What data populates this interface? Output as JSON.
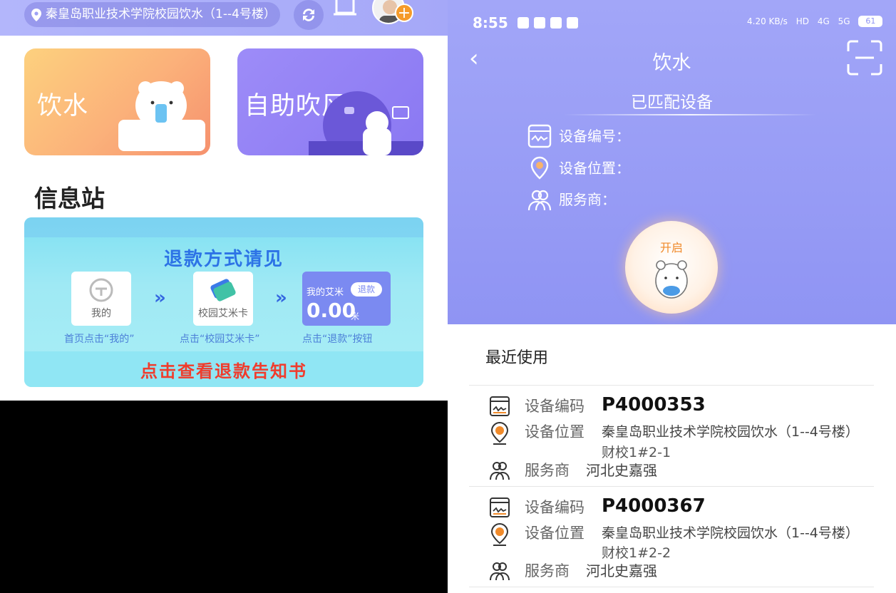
{
  "left": {
    "location": "秦皇岛职业技术学院校园饮水（1--4号楼）",
    "cards": {
      "water_label": "饮水",
      "dryer_label": "自助吹风"
    },
    "info_title": "信息站",
    "banner": {
      "title": "退款方式请见",
      "step1_box": "我的",
      "step2_box": "校园艾米卡",
      "step3_label": "我的艾米",
      "step3_tag": "退款",
      "step3_amount": "0.00",
      "step3_unit": "米",
      "step1_caption": "首页点击“我的”",
      "step2_caption": "点击“校园艾米卡”",
      "step3_caption": "点击“退款”按钮",
      "cta": "点击查看退款告知书"
    }
  },
  "right": {
    "status": {
      "time": "8:55",
      "speed": "4.20 KB/s",
      "net1": "HD",
      "net2": "4G",
      "net3": "5G",
      "battery": "61"
    },
    "title": "饮水",
    "matched": "已匹配设备",
    "device": {
      "code_label": "设备编号：",
      "location_label": "设备位置：",
      "vendor_label": "服务商："
    },
    "open_label": "开启",
    "recent_title": "最近使用",
    "recent": [
      {
        "code_key": "设备编码",
        "code": "P4000353",
        "loc_key": "设备位置",
        "loc": "秦皇岛职业技术学院校园饮水（1--4号楼）",
        "loc_sub": "财校1#2-1",
        "vendor_key": "服务商",
        "vendor": "河北史嘉强"
      },
      {
        "code_key": "设备编码",
        "code": "P4000367",
        "loc_key": "设备位置",
        "loc": "秦皇岛职业技术学院校园饮水（1--4号楼）",
        "loc_sub": "财校1#2-2",
        "vendor_key": "服务商",
        "vendor": "河北史嘉强"
      }
    ]
  },
  "colors": {
    "accent_purple": "#9598f5",
    "orange": "#f08a2a",
    "banner_blue": "#2d73e6",
    "cta_red": "#f03c2c"
  },
  "icons": [
    "location-pin-icon",
    "refresh-icon",
    "bell-icon",
    "avatar",
    "plus-icon",
    "back-arrow-icon",
    "scan-icon",
    "device-code-icon",
    "device-location-icon",
    "vendor-icon"
  ]
}
